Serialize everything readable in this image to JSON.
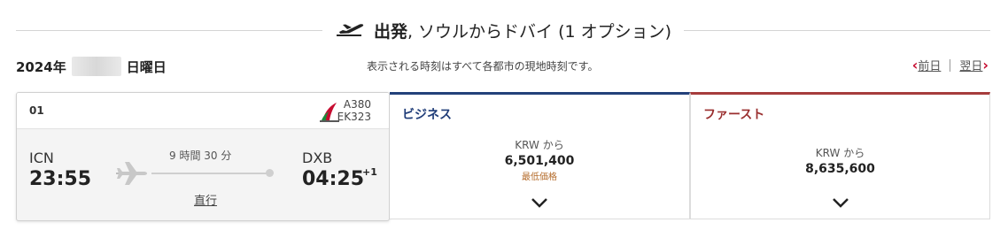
{
  "header": {
    "departure_label": "出発",
    "route_text": ", ソウルからドバイ (1 オプション)"
  },
  "date_bar": {
    "year_prefix": "2024年",
    "weekday": "日曜日",
    "notice": "表示される時刻はすべて各都市の現地時刻です。",
    "prev_label": "前日",
    "next_label": "翌日"
  },
  "flight": {
    "index": "01",
    "aircraft": "A380",
    "flight_number": "EK323",
    "origin_code": "ICN",
    "depart_time": "23:55",
    "duration": "9 時間 30 分",
    "dest_code": "DXB",
    "arrive_time": "04:25",
    "day_offset": "+1",
    "stops_label": "直行"
  },
  "fares": [
    {
      "cabin": "ビジネス",
      "from_label": "KRW から",
      "price": "6,501,400",
      "badge": "最低価格",
      "color": "#23417a"
    },
    {
      "cabin": "ファースト",
      "from_label": "KRW から",
      "price": "8,635,600",
      "badge": "",
      "color": "#a63c3c"
    }
  ],
  "icons": {
    "header": "plane-takeoff-icon",
    "route": "plane-icon",
    "expand": "chevron-down-icon",
    "nav": "chevron-left-icon / chevron-right-icon",
    "airline": "airline-logo"
  }
}
